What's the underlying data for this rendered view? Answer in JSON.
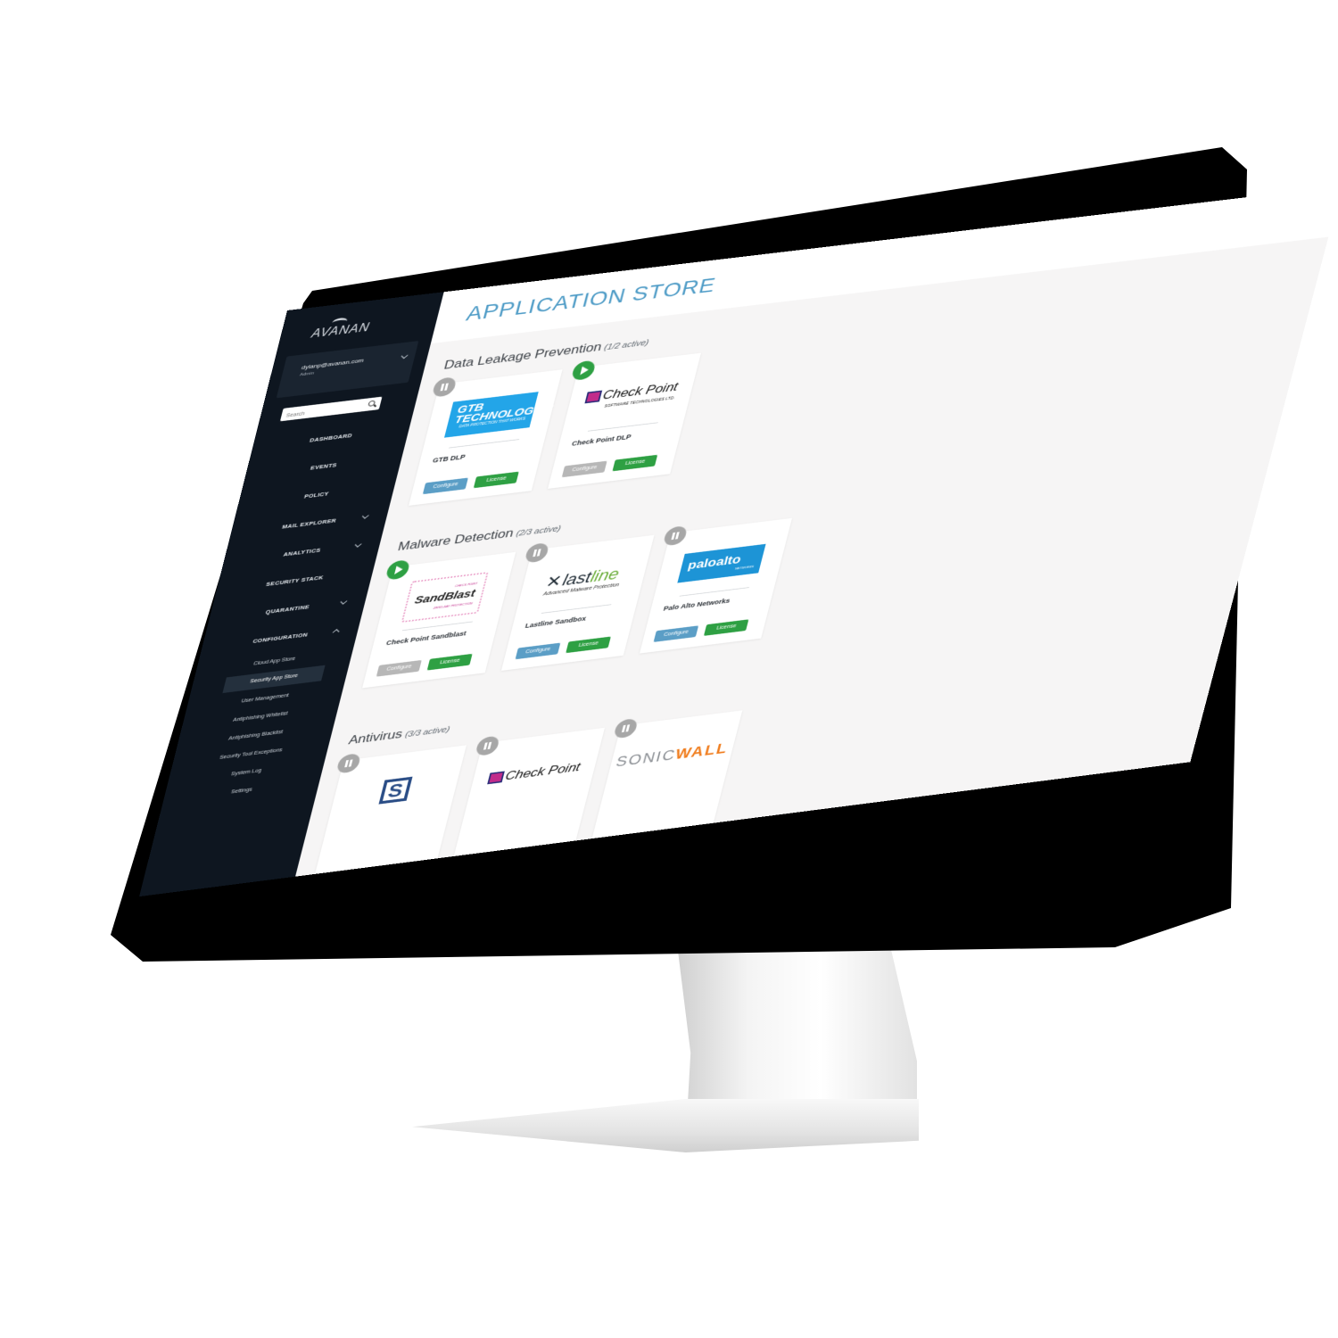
{
  "brand": "AVANAN",
  "user": {
    "email": "dylanp@avanan.com",
    "role": "Admin"
  },
  "search": {
    "placeholder": "Search"
  },
  "nav": {
    "dashboard": "DASHBOARD",
    "events": "EVENTS",
    "policy": "POLICY",
    "mail_explorer": "MAIL EXPLORER",
    "analytics": "ANALYTICS",
    "security_stack": "SECURITY STACK",
    "quarantine": "QUARANTINE",
    "configuration": "CONFIGURATION"
  },
  "config_sub": {
    "cloud_app_store": "Cloud App Store",
    "security_app_store": "Security App Store",
    "user_management": "User Management",
    "antiphishing_whitelist": "Antiphishing Whitelist",
    "antiphishing_blacklist": "Antiphishing Blacklist",
    "security_tool_exceptions": "Security Tool Exceptions",
    "system_log": "System Log",
    "settings": "Settings"
  },
  "page_title": "APPLICATION STORE",
  "buttons": {
    "configure": "Configure",
    "license": "License"
  },
  "sections": {
    "dlp": {
      "title": "Data Leakage Prevention",
      "count": "(1/2 active)",
      "cards": [
        {
          "name": "GTB DLP",
          "status": "paused",
          "logo_l1": "GTB",
          "logo_l2": "TECHNOLOGIES",
          "logo_tag": "DATA PROTECTION THAT WORKS"
        },
        {
          "name": "Check Point DLP",
          "status": "active",
          "logo": "Check Point",
          "logo_tag": "SOFTWARE TECHNOLOGIES LTD."
        }
      ]
    },
    "malware": {
      "title": "Malware Detection",
      "count": "(2/3 active)",
      "cards": [
        {
          "name": "Check Point Sandblast",
          "status": "active",
          "logo_top": "CHECK POINT",
          "logo": "SandBlast",
          "logo_tag": "ZERO-DAY PROTECTION"
        },
        {
          "name": "Lastline Sandbox",
          "status": "paused",
          "logo_a": "last",
          "logo_b": "line",
          "logo_tag": "Advanced Malware Protection"
        },
        {
          "name": "Palo Alto Networks",
          "status": "paused",
          "logo": "paloalto",
          "logo_tag": "NETWORKS"
        }
      ]
    },
    "antivirus": {
      "title": "Antivirus",
      "count": "(3/3 active)",
      "cards": [
        {
          "status": "paused",
          "logo": "S"
        },
        {
          "status": "paused",
          "logo": "Check Point"
        },
        {
          "status": "paused",
          "logo_a": "SONIC",
          "logo_b": "WALL"
        }
      ]
    }
  },
  "colors": {
    "sidebar_bg": "#0e1620",
    "title_blue": "#4d9bc6",
    "license_green": "#2ea043",
    "configure_blue": "#5b9ec6",
    "configure_disabled": "#b7b7b7",
    "paused_gray": "#a7a7a7"
  }
}
